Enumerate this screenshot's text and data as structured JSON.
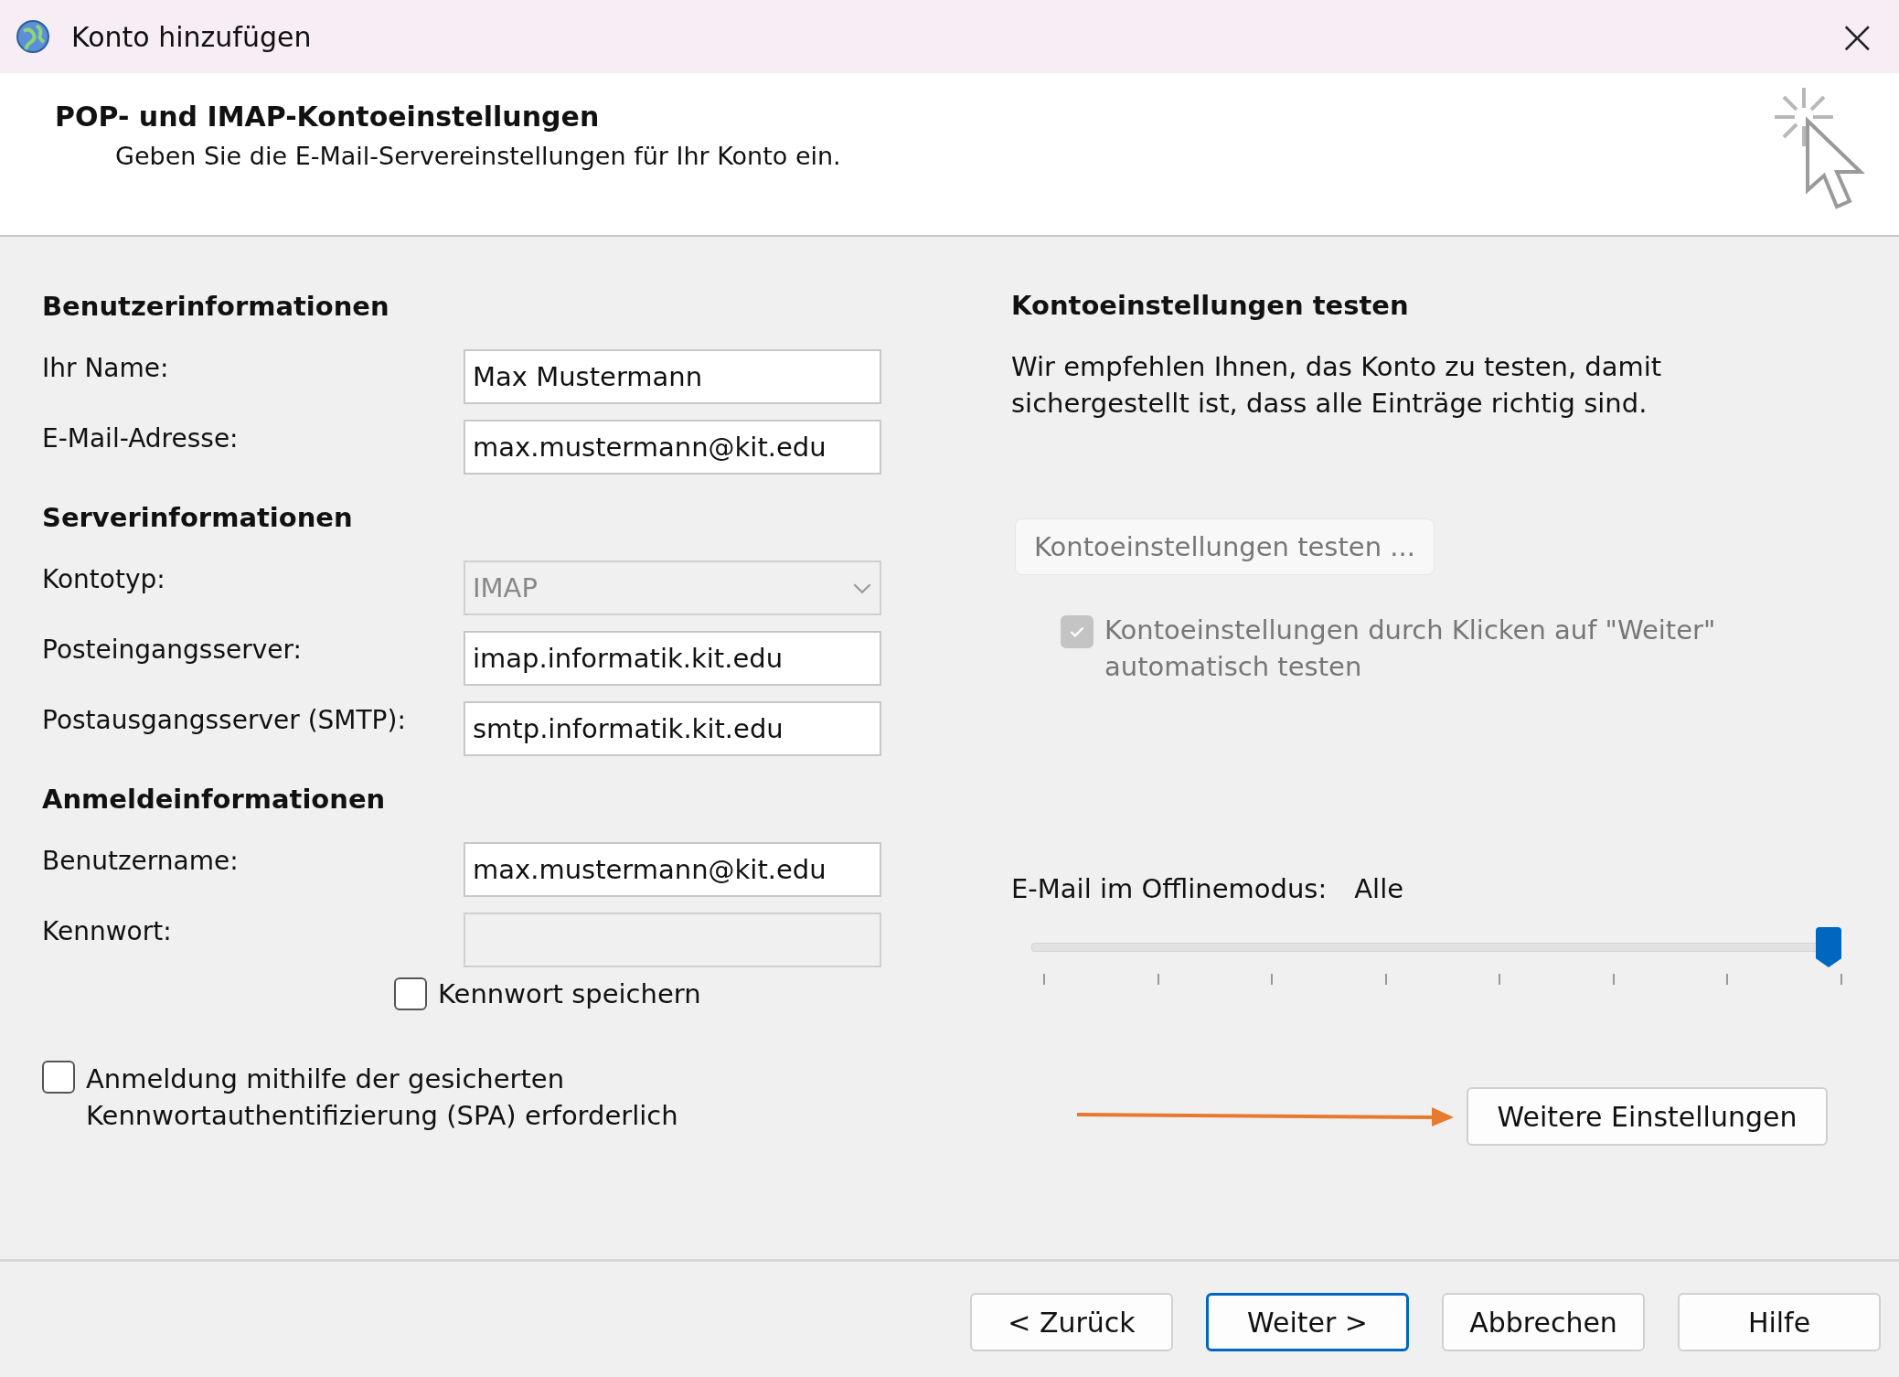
{
  "window": {
    "title": "Konto hinzufügen",
    "close": "×"
  },
  "header": {
    "title": "POP- und IMAP-Kontoeinstellungen",
    "subtitle": "Geben Sie die E-Mail-Servereinstellungen für Ihr Konto ein."
  },
  "left": [
    {
      "kind": "heading",
      "label": "Benutzerinformationen"
    },
    {
      "kind": "field",
      "label": "Ihr Name:",
      "value": "Max Mustermann",
      "disabled": false
    },
    {
      "kind": "field",
      "label": "E-Mail-Adresse:",
      "value": "max.mustermann@kit.edu",
      "disabled": false
    },
    {
      "kind": "heading",
      "label": "Serverinformationen"
    },
    {
      "kind": "select",
      "label": "Kontotyp:",
      "value": "IMAP",
      "disabled": true
    },
    {
      "kind": "field",
      "label": "Posteingangsserver:",
      "value": "imap.informatik.kit.edu",
      "disabled": false
    },
    {
      "kind": "field",
      "label": "Postausgangsserver (SMTP):",
      "value": "smtp.informatik.kit.edu",
      "disabled": false
    },
    {
      "kind": "heading",
      "label": "Anmeldeinformationen"
    },
    {
      "kind": "field",
      "label": "Benutzername:",
      "value": "max.mustermann@kit.edu",
      "disabled": false
    },
    {
      "kind": "field",
      "label": "Kennwort:",
      "disabled": true
    }
  ],
  "save_password": {
    "label": "Kennwort speichern",
    "checked": false
  },
  "spa": {
    "label": "Anmeldung mithilfe der gesicherten Kennwortauthentifizierung (SPA) erforderlich",
    "checked": false
  },
  "test": {
    "heading": "Kontoeinstellungen testen",
    "text": "Wir empfehlen Ihnen, das Konto zu testen, damit sichergestellt ist, dass alle Einträge richtig sind.",
    "button": {
      "label": "Kontoeinstellungen testen ...",
      "disabled": true
    },
    "auto": {
      "label": "Kontoeinstellungen durch Klicken auf \"Weiter\" automatisch testen",
      "checked": true,
      "disabled": true
    }
  },
  "offline": {
    "label": "E-Mail im Offlinemodus:",
    "reading": "Alle",
    "level": 1
  },
  "more_button": "Weitere Einstellungen",
  "buttons": [
    {
      "label": "< Zurück",
      "default": false
    },
    {
      "label": "Weiter >",
      "default": true
    },
    {
      "label": "Abbrechen",
      "default": false
    },
    {
      "label": "Hilfe",
      "default": false
    }
  ]
}
